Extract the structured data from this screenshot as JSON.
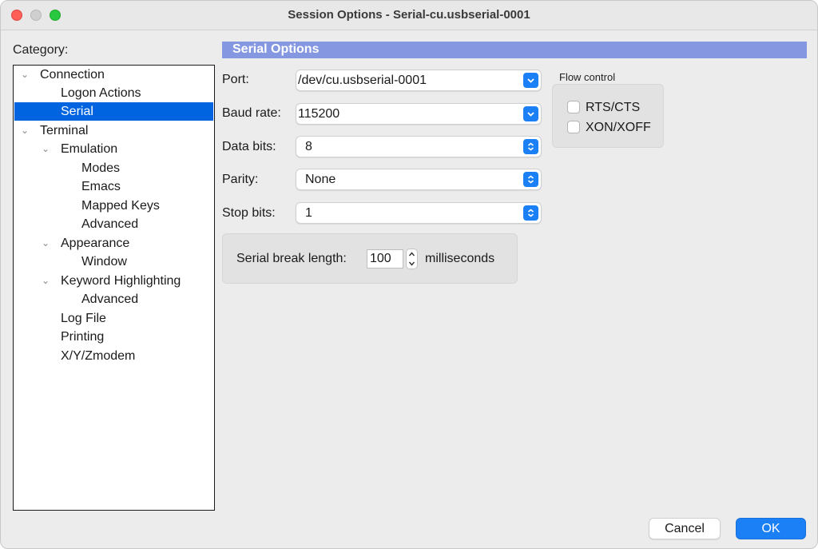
{
  "window": {
    "title": "Session Options - Serial-cu.usbserial-0001"
  },
  "category": {
    "label": "Category:",
    "items": [
      {
        "label": "Connection",
        "expanded": true,
        "selected": false
      },
      {
        "label": "Logon Actions",
        "selected": false
      },
      {
        "label": "Serial",
        "selected": true
      },
      {
        "label": "Terminal",
        "expanded": true,
        "selected": false
      },
      {
        "label": "Emulation",
        "expanded": true,
        "selected": false
      },
      {
        "label": "Modes",
        "selected": false
      },
      {
        "label": "Emacs",
        "selected": false
      },
      {
        "label": "Mapped Keys",
        "selected": false
      },
      {
        "label": "Advanced",
        "selected": false
      },
      {
        "label": "Appearance",
        "expanded": true,
        "selected": false
      },
      {
        "label": "Window",
        "selected": false
      },
      {
        "label": "Keyword Highlighting",
        "expanded": true,
        "selected": false
      },
      {
        "label": "Advanced",
        "selected": false
      },
      {
        "label": "Log File",
        "selected": false
      },
      {
        "label": "Printing",
        "selected": false
      },
      {
        "label": "X/Y/Zmodem",
        "selected": false
      }
    ]
  },
  "serial": {
    "header": "Serial Options",
    "port": {
      "label": "Port:",
      "value": "/dev/cu.usbserial-0001"
    },
    "baud": {
      "label": "Baud rate:",
      "value": "115200"
    },
    "data_bits": {
      "label": "Data bits:",
      "value": "8"
    },
    "parity": {
      "label": "Parity:",
      "value": "None"
    },
    "stop_bits": {
      "label": "Stop bits:",
      "value": "1"
    },
    "flow_control": {
      "title": "Flow control",
      "rts_cts": {
        "label": "RTS/CTS",
        "checked": false
      },
      "xon_xoff": {
        "label": "XON/XOFF",
        "checked": false
      }
    },
    "break": {
      "label": "Serial break length:",
      "value": "100",
      "unit": "milliseconds"
    }
  },
  "buttons": {
    "cancel": "Cancel",
    "ok": "OK"
  },
  "colors": {
    "accent": "#1b7ff6",
    "selection": "#0064e1",
    "header": "#8497e0"
  }
}
